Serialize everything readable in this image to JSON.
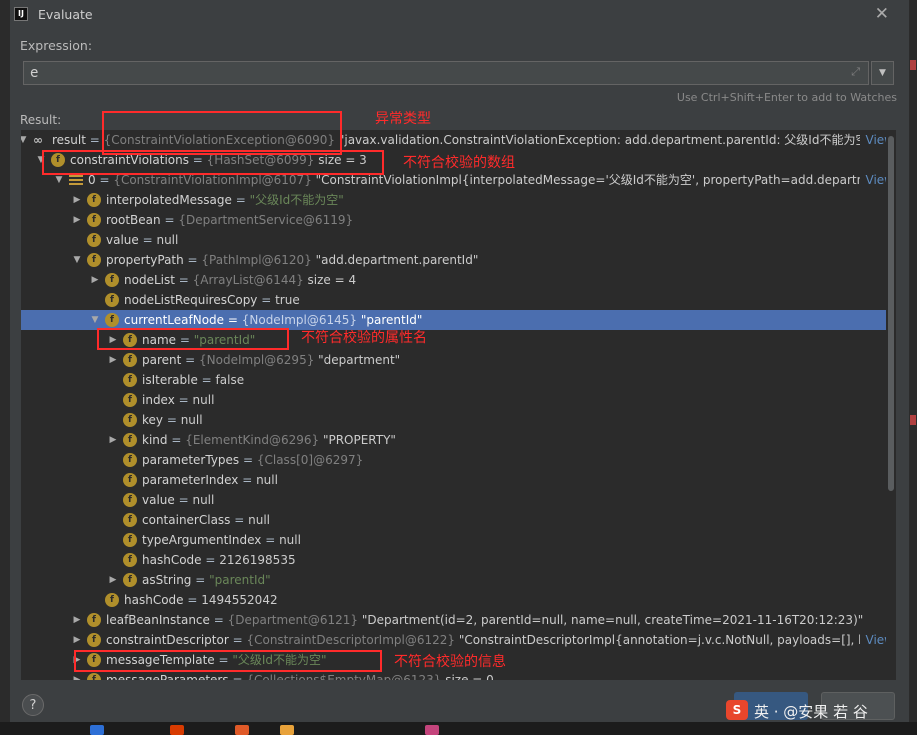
{
  "window": {
    "app_icon": "intellij-icon",
    "app_icon_text": "IJ",
    "title": "Evaluate",
    "close_glyph": "✕"
  },
  "expression": {
    "label": "Expression:",
    "value": "e",
    "expand_glyph": "⤢",
    "history_glyph": "▼",
    "hint": "Use Ctrl+Shift+Enter to add to Watches"
  },
  "result_label": "Result:",
  "tree": [
    {
      "arrow": "▼",
      "icon": "infinity",
      "name": "result",
      "type": "{ConstraintViolationException@6090}",
      "value": "\"javax.validation.ConstraintViolationException: add.department.parentId: 父级Id不能为空, ac",
      "value_class": "v",
      "view": "View"
    },
    {
      "arrow": "▼",
      "icon": "field",
      "name": "constraintViolations",
      "type": "{HashSet@6099}",
      "value": " size = 3",
      "value_class": "v"
    },
    {
      "arrow": "▼",
      "icon": "array",
      "name": "0",
      "type": "{ConstraintViolationImpl@6107}",
      "value": "\"ConstraintViolationImpl{interpolatedMessage='父级Id不能为空', propertyPath=add.departme",
      "value_class": "v",
      "view": "View"
    },
    {
      "arrow": "▶",
      "icon": "field",
      "name": "interpolatedMessage",
      "type": "",
      "value": "\"父级Id不能为空\"",
      "value_class": "s"
    },
    {
      "arrow": "▶",
      "icon": "field",
      "name": "rootBean",
      "type": "{DepartmentService@6119}",
      "value": "",
      "value_class": "v"
    },
    {
      "arrow": "",
      "icon": "field",
      "name": "value",
      "type": "",
      "value": "null",
      "value_class": "v"
    },
    {
      "arrow": "▼",
      "icon": "field",
      "name": "propertyPath",
      "type": "{PathImpl@6120}",
      "value": "\"add.department.parentId\"",
      "value_class": "v"
    },
    {
      "arrow": "▶",
      "icon": "field",
      "name": "nodeList",
      "type": "{ArrayList@6144}",
      "value": " size = 4",
      "value_class": "v"
    },
    {
      "arrow": "",
      "icon": "field",
      "name": "nodeListRequiresCopy",
      "type": "",
      "value": "true",
      "value_class": "v"
    },
    {
      "arrow": "▼",
      "icon": "field",
      "name": "currentLeafNode",
      "type": "{NodeImpl@6145}",
      "value": "\"parentId\"",
      "value_class": "v",
      "selected": true
    },
    {
      "arrow": "▶",
      "icon": "field",
      "name": "name",
      "type": "",
      "value": "\"parentId\"",
      "value_class": "s"
    },
    {
      "arrow": "▶",
      "icon": "field",
      "name": "parent",
      "type": "{NodeImpl@6295}",
      "value": "\"department\"",
      "value_class": "v"
    },
    {
      "arrow": "",
      "icon": "field",
      "name": "isIterable",
      "type": "",
      "value": "false",
      "value_class": "v"
    },
    {
      "arrow": "",
      "icon": "field",
      "name": "index",
      "type": "",
      "value": "null",
      "value_class": "v"
    },
    {
      "arrow": "",
      "icon": "field",
      "name": "key",
      "type": "",
      "value": "null",
      "value_class": "v"
    },
    {
      "arrow": "▶",
      "icon": "field",
      "name": "kind",
      "type": "{ElementKind@6296}",
      "value": "\"PROPERTY\"",
      "value_class": "v"
    },
    {
      "arrow": "",
      "icon": "field",
      "name": "parameterTypes",
      "type": "{Class[0]@6297}",
      "value": "",
      "value_class": "v"
    },
    {
      "arrow": "",
      "icon": "field",
      "name": "parameterIndex",
      "type": "",
      "value": "null",
      "value_class": "v"
    },
    {
      "arrow": "",
      "icon": "field",
      "name": "value",
      "type": "",
      "value": "null",
      "value_class": "v"
    },
    {
      "arrow": "",
      "icon": "field",
      "name": "containerClass",
      "type": "",
      "value": "null",
      "value_class": "v"
    },
    {
      "arrow": "",
      "icon": "field",
      "name": "typeArgumentIndex",
      "type": "",
      "value": "null",
      "value_class": "v"
    },
    {
      "arrow": "",
      "icon": "field",
      "name": "hashCode",
      "type": "",
      "value": "2126198535",
      "value_class": "v"
    },
    {
      "arrow": "▶",
      "icon": "field",
      "name": "asString",
      "type": "",
      "value": "\"parentId\"",
      "value_class": "s"
    },
    {
      "arrow": "",
      "icon": "field",
      "name": "hashCode",
      "type": "",
      "value": "1494552042",
      "value_class": "v"
    },
    {
      "arrow": "▶",
      "icon": "field",
      "name": "leafBeanInstance",
      "type": "{Department@6121}",
      "value": "\"Department(id=2, parentId=null, name=null, createTime=2021-11-16T20:12:23)\"",
      "value_class": "v"
    },
    {
      "arrow": "▶",
      "icon": "field",
      "name": "constraintDescriptor",
      "type": "{ConstraintDescriptorImpl@6122}",
      "value": "\"ConstraintDescriptorImpl{annotation=j.v.c.NotNull, payloads=[], hasC",
      "value_class": "v",
      "view": "View"
    },
    {
      "arrow": "▶",
      "icon": "field",
      "name": "messageTemplate",
      "type": "",
      "value": "\"父级Id不能为空\"",
      "value_class": "s"
    },
    {
      "arrow": "▶",
      "icon": "field",
      "name": "messageParameters",
      "type": "{Collections$EmptyMap@6123}",
      "value": " size = 0",
      "value_class": "v"
    }
  ],
  "annotations": {
    "exception_type": "异常类型",
    "violations_array": "不符合校验的数组",
    "property_name": "不符合校验的属性名",
    "violation_message": "不符合校验的信息"
  },
  "footer": {
    "help_label": "?",
    "watermark_logo": "S",
    "watermark_text": "英 ·  @安果 若 谷"
  },
  "colors": {
    "background": "#3c3f41",
    "tree_background": "#2b2b2b",
    "selection": "#4b6eaf",
    "string_value": "#6a8759",
    "annotation_red": "#ff2b2b",
    "field_badge": "#b08f2b",
    "link": "#5d8bbf"
  }
}
